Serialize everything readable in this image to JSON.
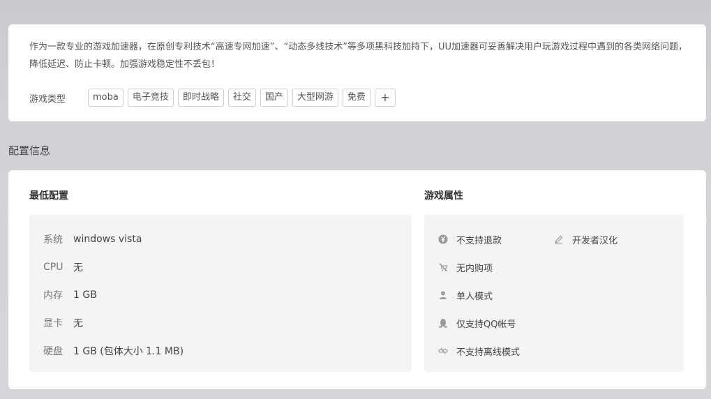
{
  "description": {
    "text": "作为一款专业的游戏加速器，在原创专利技术“高速专网加速”、“动态多线技术”等多项黑科技加持下，UU加速器可妥善解决用户玩游戏过程中遇到的各类网络问题，降低延迟、防止卡顿。加强游戏稳定性不丢包！"
  },
  "game_types": {
    "label": "游戏类型",
    "tags": [
      "moba",
      "电子竞技",
      "即时战略",
      "社交",
      "国产",
      "大型网游",
      "免费"
    ],
    "add_label": "+"
  },
  "config_section": {
    "title": "配置信息"
  },
  "min_config": {
    "title": "最低配置",
    "rows": [
      {
        "key": "系统",
        "value": "windows vista"
      },
      {
        "key": "CPU",
        "value": "无"
      },
      {
        "key": "内存",
        "value": "1 GB"
      },
      {
        "key": "显卡",
        "value": "无"
      },
      {
        "key": "硬盘",
        "value": "1 GB (包体大小 1.1 MB)"
      }
    ]
  },
  "game_attributes": {
    "title": "游戏属性",
    "items": [
      {
        "icon": "yen-circle-icon",
        "label": "不支持退款"
      },
      {
        "icon": "pencil-icon",
        "label": "开发者汉化"
      },
      {
        "icon": "no-purchase-icon",
        "label": "无内购项"
      },
      {
        "icon": "single-player-icon",
        "label": "单人模式"
      },
      {
        "icon": "qq-penguin-icon",
        "label": "仅支持QQ帐号"
      },
      {
        "icon": "offline-link-icon",
        "label": "不支持离线模式"
      }
    ]
  }
}
